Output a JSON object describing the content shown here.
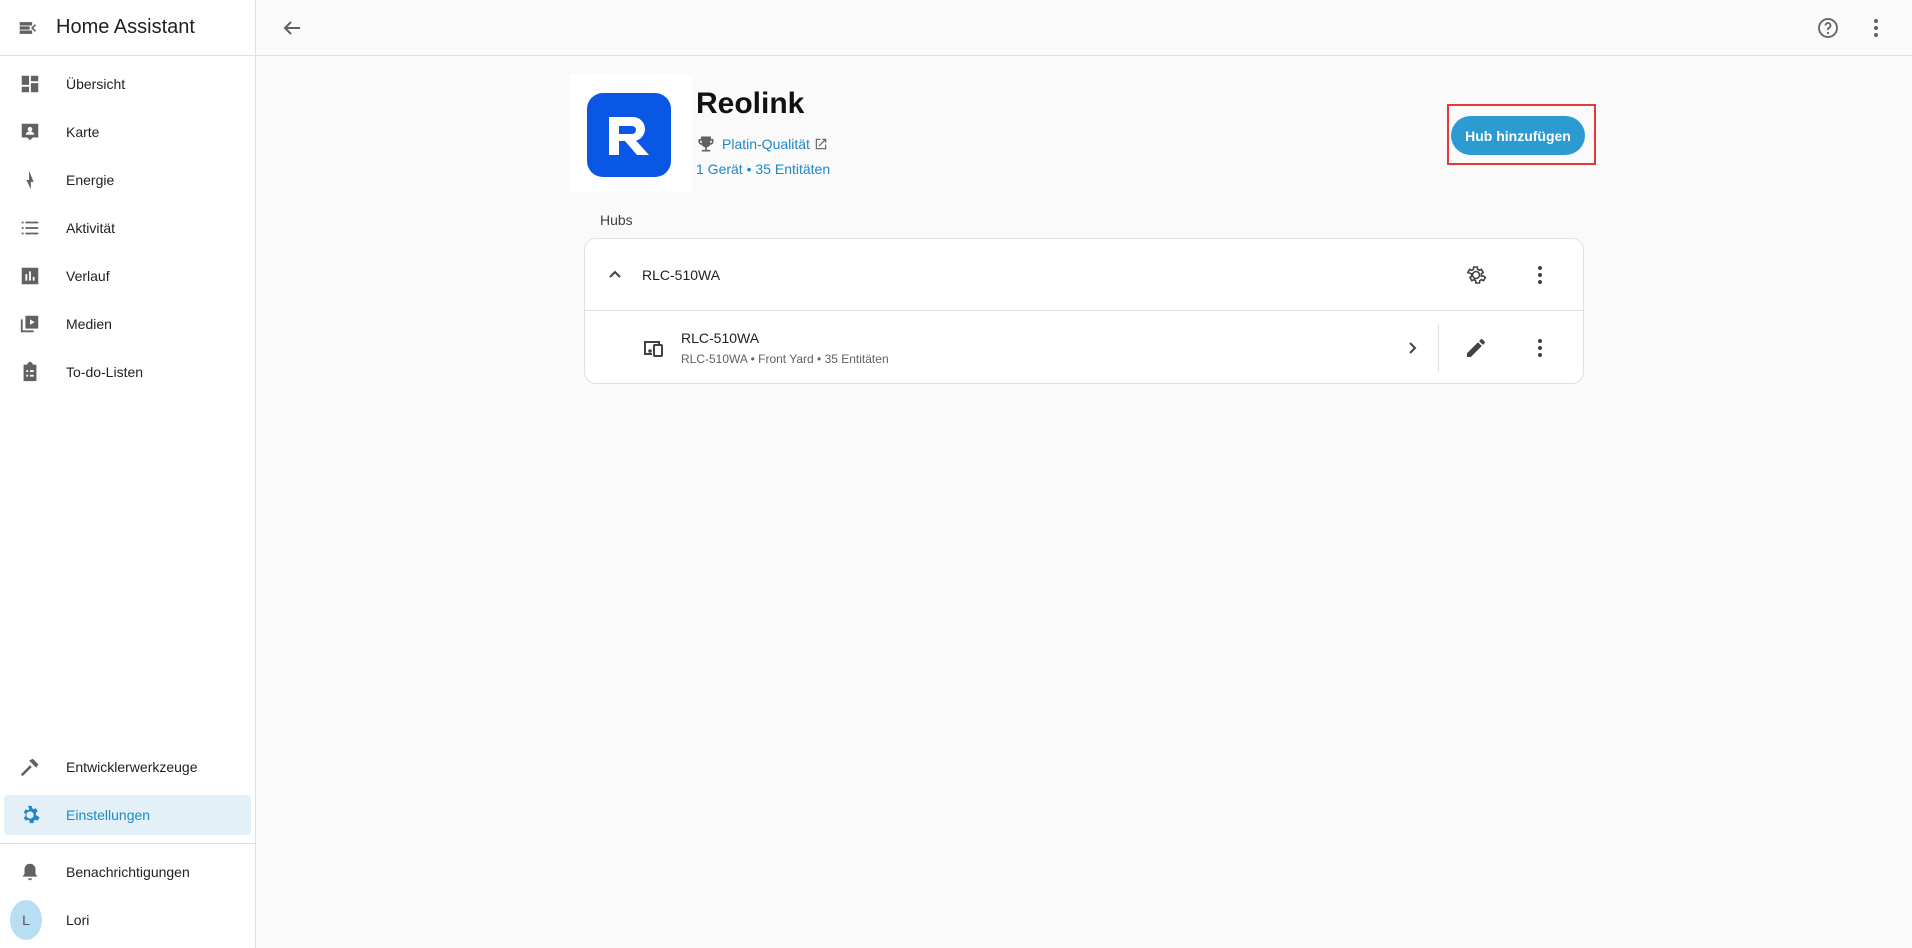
{
  "app": {
    "title": "Home Assistant"
  },
  "sidebar": {
    "items": [
      {
        "label": "Übersicht",
        "icon": "dashboard-icon"
      },
      {
        "label": "Karte",
        "icon": "map-icon"
      },
      {
        "label": "Energie",
        "icon": "lightning-icon"
      },
      {
        "label": "Aktivität",
        "icon": "list-icon"
      },
      {
        "label": "Verlauf",
        "icon": "chart-icon"
      },
      {
        "label": "Medien",
        "icon": "media-icon"
      },
      {
        "label": "To-do-Listen",
        "icon": "clipboard-icon"
      }
    ],
    "bottom_items": [
      {
        "label": "Entwicklerwerkzeuge",
        "icon": "hammer-icon"
      },
      {
        "label": "Einstellungen",
        "icon": "gear-icon",
        "active": true
      }
    ],
    "notifications_label": "Benachrichtigungen",
    "user": {
      "name": "Lori",
      "initial": "L"
    }
  },
  "integration": {
    "name": "Reolink",
    "quality_label": "Platin-Qualität",
    "devices_label": "1 Gerät",
    "separator": " • ",
    "entities_label": "35 Entitäten",
    "add_button": "Hub hinzufügen"
  },
  "hubs": {
    "section_label": "Hubs",
    "entries": [
      {
        "name": "RLC-510WA",
        "devices": [
          {
            "name": "RLC-510WA",
            "subtitle": "RLC-510WA • Front Yard • 35 Entitäten"
          }
        ]
      }
    ]
  },
  "colors": {
    "accent": "#2b9bd1",
    "link": "#1e88c7",
    "active_bg": "#e3f0f8",
    "logo_bg": "#0a57e6",
    "highlight": "#e53935"
  }
}
